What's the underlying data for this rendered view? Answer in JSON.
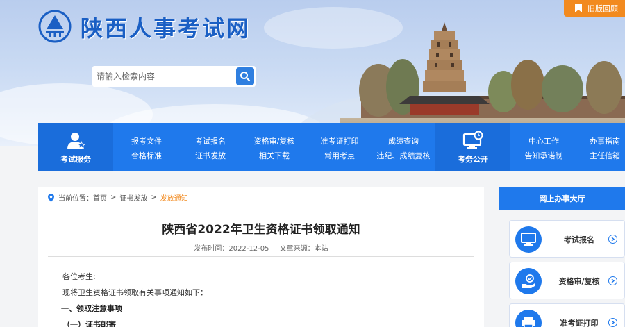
{
  "header": {
    "site_title": "陕西人事考试网",
    "search_placeholder": "请输入检索内容",
    "old_version_label": "旧版回顾"
  },
  "nav": {
    "exam_service_label": "考试服务",
    "exam_affairs_label": "考务公开",
    "columns": [
      [
        "报考文件",
        "合格标准"
      ],
      [
        "考试报名",
        "证书发放"
      ],
      [
        "资格审/复核",
        "相关下载"
      ],
      [
        "准考证打印",
        "常用考点"
      ],
      [
        "成绩查询",
        "违纪、成绩复核"
      ],
      [
        "中心工作",
        "告知承诺制"
      ],
      [
        "办事指南",
        "主任信箱"
      ]
    ]
  },
  "breadcrumb": {
    "prefix": "当前位置：",
    "items": [
      "首页",
      "证书发放"
    ],
    "current": "发放通知",
    "separator": ">"
  },
  "article": {
    "title": "陕西省2022年卫生资格证书领取通知",
    "publish_label": "发布时间：",
    "publish_date": "2022-12-05",
    "source_label": "文章来源：",
    "source": "本站",
    "lines": [
      "各位考生:",
      "现将卫生资格证书领取有关事项通知如下：",
      "一、领取注意事项",
      "（一）证书邮寄"
    ]
  },
  "sidebar": {
    "title": "网上办事大厅",
    "items": [
      "考试报名",
      "资格审/复核",
      "准考证打印"
    ]
  },
  "colors": {
    "primary_blue": "#1f79ec",
    "accent_orange": "#f28a1f"
  }
}
